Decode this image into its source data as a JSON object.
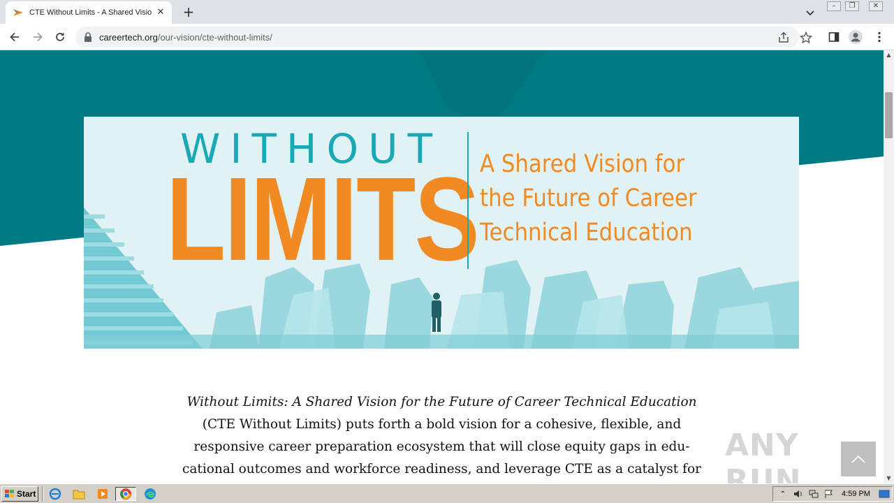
{
  "browser": {
    "tab_title": "CTE Without Limits - A Shared Vision",
    "tab_close": "✕",
    "new_tab": "+",
    "url_domain": "careertech.org",
    "url_path": "/our-vision/cte-without-limits/",
    "window_controls": [
      "–",
      "❐",
      "✕"
    ]
  },
  "banner": {
    "word_without": "WITHOUT",
    "word_limits": "LIMITS",
    "tagline_lines": [
      "A Shared Vision for",
      "the Future of Career",
      "Technical Education"
    ]
  },
  "article": {
    "italic_title": "Without Limits: A Shared Vision for the Future of Career Technical Education",
    "lines": [
      "(CTE Without Limits) puts forth a bold vision for a cohesive, flexible, and",
      "responsive career preparation ecosystem that will close equity gaps in edu-",
      "cational outcomes and workforce readiness, and leverage CTE as a catalyst for"
    ]
  },
  "watermark": "ANY RUN",
  "taskbar": {
    "start_label": "Start",
    "clock": "4:59 PM"
  },
  "colors": {
    "teal": "#007a82",
    "banner_teal": "#1ba8b5",
    "orange": "#f28a24",
    "banner_bg": "#e1f2f5"
  }
}
